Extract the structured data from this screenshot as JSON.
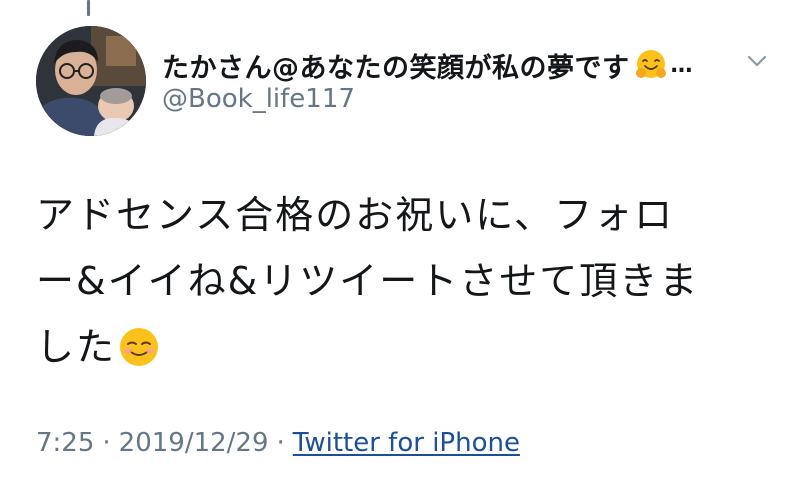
{
  "tweet": {
    "display_name": "たかさん@あなたの笑顔が私の夢です",
    "name_emoji": "hugging-face-emoji",
    "truncation": "…",
    "handle": "@Book_life117",
    "text_lines": [
      "アドセンス合格のお祝いに、フォロ",
      "ー&イイね&リツイートさせて頂きま",
      "した"
    ],
    "text_emoji": "smiling-face-emoji",
    "time": "7:25",
    "separator": "·",
    "date": "2019/12/29",
    "source": "Twitter for iPhone"
  },
  "icons": {
    "menu": "chevron-down-icon",
    "avatar": "avatar-photo"
  },
  "colors": {
    "text": "#14171a",
    "secondary": "#657786",
    "link": "#1b4f9c",
    "background": "#ffffff"
  }
}
